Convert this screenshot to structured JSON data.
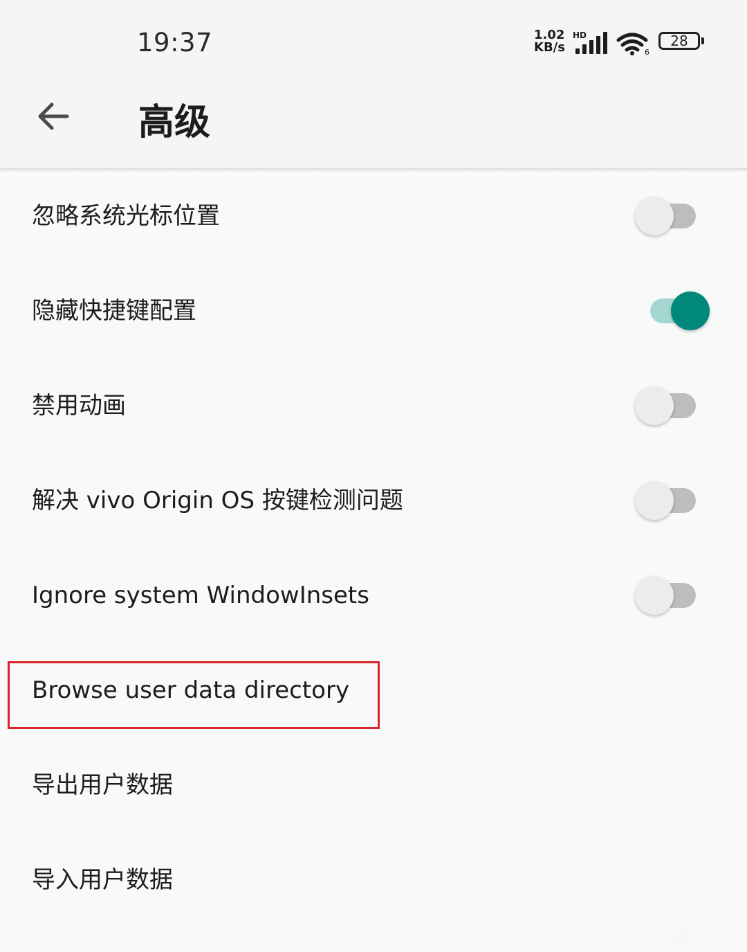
{
  "status_bar": {
    "time": "19:37",
    "net_speed_value": "1.02",
    "net_speed_unit": "KB/s",
    "network_type": "HD",
    "battery_level": "28",
    "icons": [
      "signal-icon",
      "wifi-icon",
      "battery-icon"
    ]
  },
  "toolbar": {
    "back_icon": "arrow-left-icon",
    "title": "高级"
  },
  "settings": [
    {
      "label": "忽略系统光标位置",
      "type": "switch",
      "checked": false
    },
    {
      "label": "隐藏快捷键配置",
      "type": "switch",
      "checked": true
    },
    {
      "label": "禁用动画",
      "type": "switch",
      "checked": false
    },
    {
      "label": "解决 vivo Origin OS 按键检测问题",
      "type": "switch",
      "checked": false
    },
    {
      "label": "Ignore system WindowInsets",
      "type": "switch",
      "checked": false
    },
    {
      "label": "Browse user data directory",
      "type": "action",
      "highlighted": true
    },
    {
      "label": "导出用户数据",
      "type": "action"
    },
    {
      "label": "导入用户数据",
      "type": "action"
    }
  ],
  "colors": {
    "accent": "#00897b",
    "accent_track": "#a5d7d2",
    "switch_off_thumb": "#ececec",
    "switch_off_track": "#bdbdbd",
    "highlight_border": "#d8232d",
    "background": "#f9f9f9"
  },
  "watermark": "天云山上下_水墨"
}
